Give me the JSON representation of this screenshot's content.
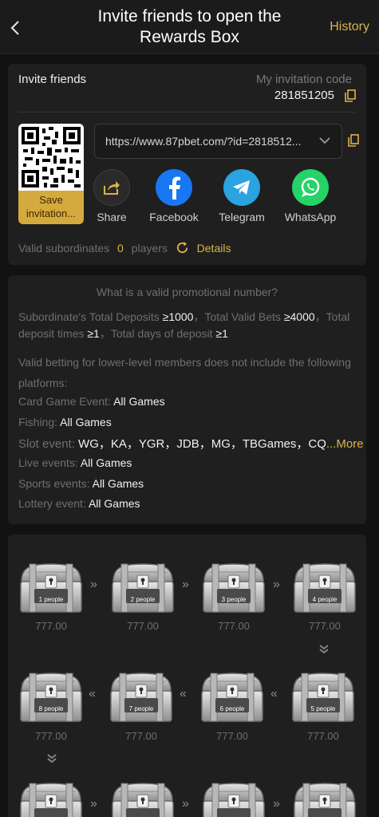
{
  "header": {
    "title_line1": "Invite friends to open the",
    "title_line2": "Rewards Box",
    "history": "History"
  },
  "invite": {
    "title": "Invite friends",
    "code_label": "My invitation code",
    "code": "281851205",
    "url": "https://www.87pbet.com/?id=2818512...",
    "qr_save_line1": "Save",
    "qr_save_line2": "invitation...",
    "share": [
      {
        "label": "Share",
        "icon": "share-icon",
        "color": "#2a2a2a"
      },
      {
        "label": "Facebook",
        "icon": "facebook-icon",
        "color": "#1877f2"
      },
      {
        "label": "Telegram",
        "icon": "telegram-icon",
        "color": "#2aa3e0"
      },
      {
        "label": "WhatsApp",
        "icon": "whatsapp-icon",
        "color": "#25d366"
      }
    ],
    "subordinates_label": "Valid subordinates",
    "subordinates_count": "0",
    "subordinates_unit": "players",
    "details": "Details"
  },
  "rules": {
    "question": "What is a valid promotional number?",
    "req_a": "Subordinate's Total Deposits ",
    "req_b": "≥1000",
    "req_c": "，Total Valid Bets ",
    "req_d": "≥4000",
    "req_e": "，Total deposit times ",
    "req_f": "≥1",
    "req_g": "，Total days of deposit ",
    "req_h": "≥1",
    "note": "Valid betting for lower-level members does not include the following platforms:",
    "events": [
      {
        "label": "Card Game Event: ",
        "value": "All Games"
      },
      {
        "label": "Fishing: ",
        "value": "All Games"
      },
      {
        "label": "Slot event: ",
        "value": "WG，KA，YGR，JDB，MG，TBGames，CQ",
        "more": "...More"
      },
      {
        "label": "Live events: ",
        "value": "All Games"
      },
      {
        "label": "Sports events: ",
        "value": "All Games"
      },
      {
        "label": "Lottery event: ",
        "value": "All Games"
      }
    ]
  },
  "boxes": [
    {
      "label": "1 people",
      "amount": "777.00"
    },
    {
      "label": "2 people",
      "amount": "777.00"
    },
    {
      "label": "3 people",
      "amount": "777.00"
    },
    {
      "label": "4 people",
      "amount": "777.00"
    },
    {
      "label": "5 people",
      "amount": "777.00"
    },
    {
      "label": "6 people",
      "amount": "777.00"
    },
    {
      "label": "7 people",
      "amount": "777.00"
    },
    {
      "label": "8 people",
      "amount": "777.00"
    }
  ],
  "colors": {
    "accent": "#d9b44a",
    "background": "#121212",
    "card": "#1f1f1f"
  }
}
